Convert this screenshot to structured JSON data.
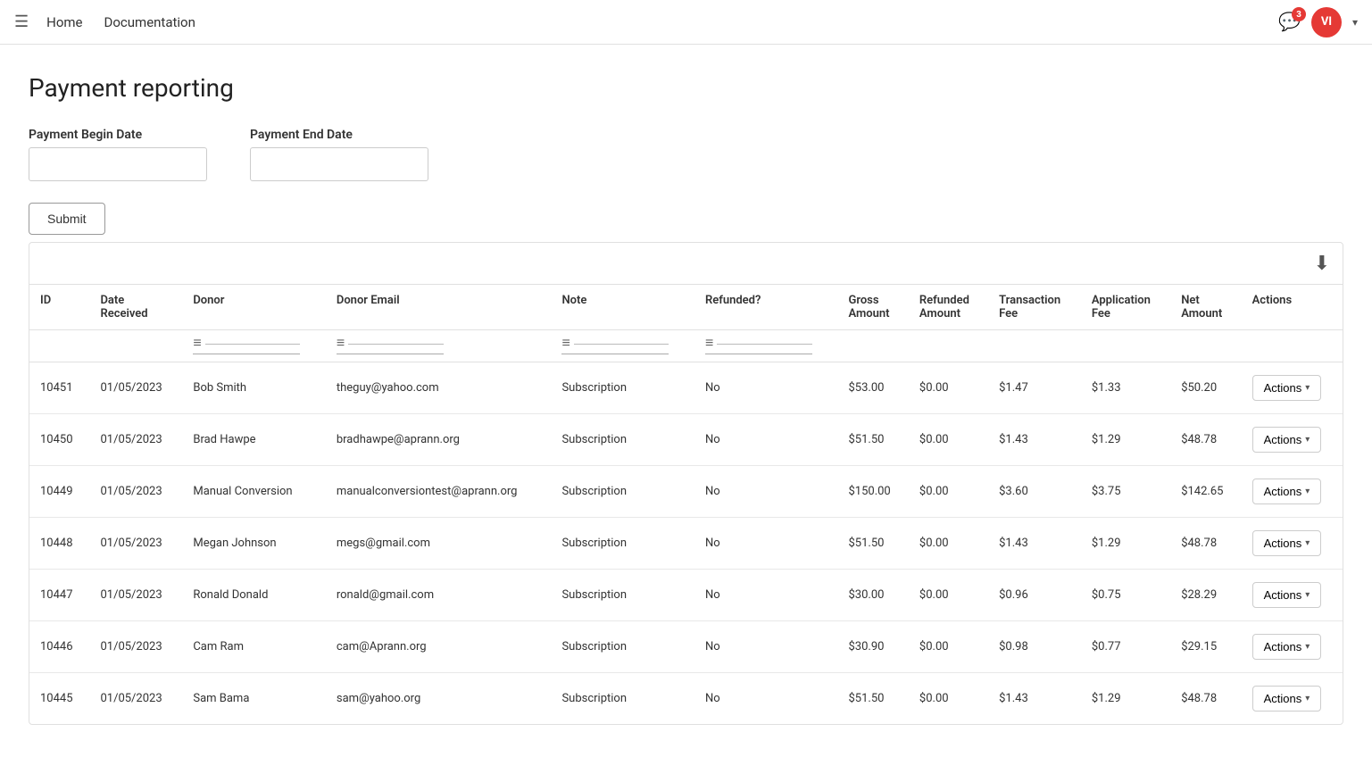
{
  "navbar": {
    "menu_icon": "☰",
    "links": [
      "Home",
      "Documentation"
    ],
    "notification_count": "3",
    "avatar_initials": "VI",
    "chevron": "▾"
  },
  "page": {
    "title": "Payment reporting"
  },
  "filters": {
    "begin_date_label": "Payment Begin Date",
    "begin_date_placeholder": "",
    "end_date_label": "Payment End Date",
    "end_date_placeholder": "",
    "submit_label": "Submit"
  },
  "table": {
    "download_icon": "⬇",
    "columns": [
      {
        "id": "id",
        "label": "ID"
      },
      {
        "id": "date_received",
        "label": "Date Received"
      },
      {
        "id": "donor",
        "label": "Donor"
      },
      {
        "id": "donor_email",
        "label": "Donor Email"
      },
      {
        "id": "note",
        "label": "Note"
      },
      {
        "id": "refunded",
        "label": "Refunded?"
      },
      {
        "id": "gross_amount",
        "label": "Gross Amount"
      },
      {
        "id": "refunded_amount",
        "label": "Refunded Amount"
      },
      {
        "id": "transaction_fee",
        "label": "Transaction Fee"
      },
      {
        "id": "application_fee",
        "label": "Application Fee"
      },
      {
        "id": "net_amount",
        "label": "Net Amount"
      },
      {
        "id": "actions",
        "label": "Actions"
      }
    ],
    "filter_icon": "≡",
    "filterable_columns": [
      "donor",
      "donor_email",
      "note",
      "refunded"
    ],
    "rows": [
      {
        "id": "10451",
        "date_received": "01/05/2023",
        "donor": "Bob Smith",
        "donor_email": "theguy@yahoo.com",
        "note": "Subscription",
        "refunded": "No",
        "gross_amount": "$53.00",
        "refunded_amount": "$0.00",
        "transaction_fee": "$1.47",
        "application_fee": "$1.33",
        "net_amount": "$50.20",
        "actions_label": "Actions"
      },
      {
        "id": "10450",
        "date_received": "01/05/2023",
        "donor": "Brad Hawpe",
        "donor_email": "bradhawpe@aprann.org",
        "note": "Subscription",
        "refunded": "No",
        "gross_amount": "$51.50",
        "refunded_amount": "$0.00",
        "transaction_fee": "$1.43",
        "application_fee": "$1.29",
        "net_amount": "$48.78",
        "actions_label": "Actions"
      },
      {
        "id": "10449",
        "date_received": "01/05/2023",
        "donor": "Manual Conversion",
        "donor_email": "manualconversiontest@aprann.org",
        "note": "Subscription",
        "refunded": "No",
        "gross_amount": "$150.00",
        "refunded_amount": "$0.00",
        "transaction_fee": "$3.60",
        "application_fee": "$3.75",
        "net_amount": "$142.65",
        "actions_label": "Actions"
      },
      {
        "id": "10448",
        "date_received": "01/05/2023",
        "donor": "Megan Johnson",
        "donor_email": "megs@gmail.com",
        "note": "Subscription",
        "refunded": "No",
        "gross_amount": "$51.50",
        "refunded_amount": "$0.00",
        "transaction_fee": "$1.43",
        "application_fee": "$1.29",
        "net_amount": "$48.78",
        "actions_label": "Actions"
      },
      {
        "id": "10447",
        "date_received": "01/05/2023",
        "donor": "Ronald Donald",
        "donor_email": "ronald@gmail.com",
        "note": "Subscription",
        "refunded": "No",
        "gross_amount": "$30.00",
        "refunded_amount": "$0.00",
        "transaction_fee": "$0.96",
        "application_fee": "$0.75",
        "net_amount": "$28.29",
        "actions_label": "Actions"
      },
      {
        "id": "10446",
        "date_received": "01/05/2023",
        "donor": "Cam Ram",
        "donor_email": "cam@Aprann.org",
        "note": "Subscription",
        "refunded": "No",
        "gross_amount": "$30.90",
        "refunded_amount": "$0.00",
        "transaction_fee": "$0.98",
        "application_fee": "$0.77",
        "net_amount": "$29.15",
        "actions_label": "Actions"
      },
      {
        "id": "10445",
        "date_received": "01/05/2023",
        "donor": "Sam Bama",
        "donor_email": "sam@yahoo.org",
        "note": "Subscription",
        "refunded": "No",
        "gross_amount": "$51.50",
        "refunded_amount": "$0.00",
        "transaction_fee": "$1.43",
        "application_fee": "$1.29",
        "net_amount": "$48.78",
        "actions_label": "Actions"
      }
    ]
  }
}
